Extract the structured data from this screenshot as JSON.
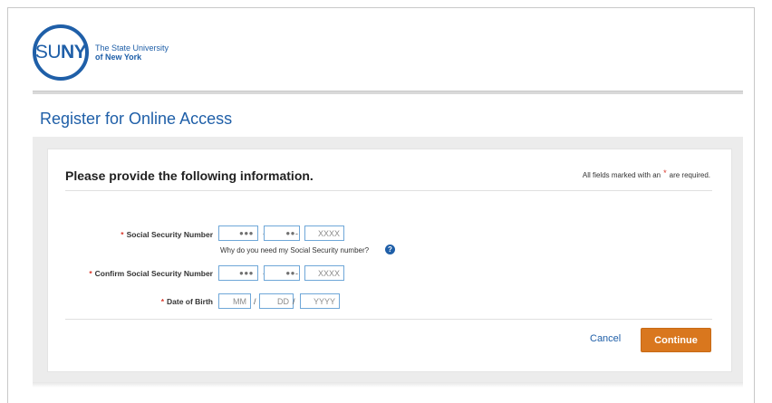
{
  "logo": {
    "mark_prefix": "SU",
    "mark_bold": "NY",
    "line1": "The State University",
    "line2": "of New York"
  },
  "page_title": "Register for Online Access",
  "form": {
    "heading": "Please provide the following information.",
    "required_note_prefix": "All fields marked with an",
    "required_star": "*",
    "required_note_suffix": "are required.",
    "ssn": {
      "label": "Social Security Number",
      "part1": "●●●",
      "part2": "●●",
      "part3_placeholder": "XXXX",
      "separator": "-",
      "help_text": "Why do you need my Social Security number?",
      "help_icon": "question-circle-icon"
    },
    "confirm_ssn": {
      "label": "Confirm Social Security Number",
      "part1": "●●●",
      "part2": "●●",
      "part3_placeholder": "XXXX",
      "separator": "-"
    },
    "dob": {
      "label": "Date of Birth",
      "month_placeholder": "MM",
      "day_placeholder": "DD",
      "year_placeholder": "YYYY",
      "separator": "/"
    }
  },
  "actions": {
    "cancel_label": "Cancel",
    "continue_label": "Continue"
  },
  "colors": {
    "brand_blue": "#1f5fa8",
    "continue_orange": "#d9771e",
    "required_red": "#d9372b",
    "field_border": "#6fa7d8"
  }
}
